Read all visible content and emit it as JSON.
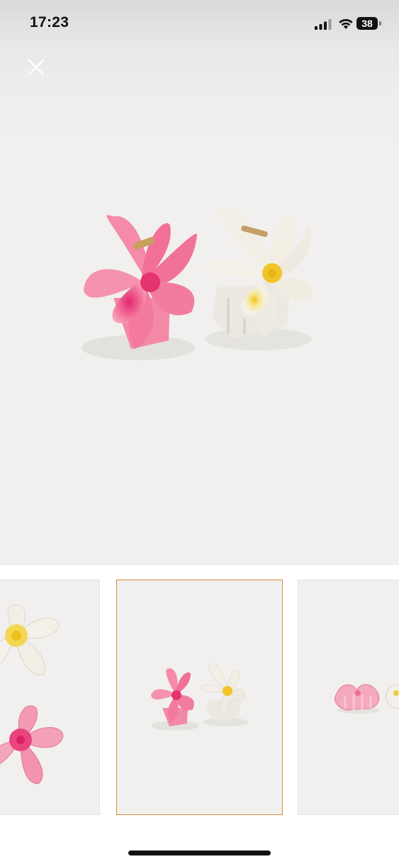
{
  "status_bar": {
    "time": "17:23",
    "battery_level": "38",
    "signal_icon": "cellular-signal-icon",
    "wifi_icon": "wifi-icon"
  },
  "toolbar": {
    "close_icon": "close-icon"
  },
  "gallery": {
    "selected_thumbnail_index": 1,
    "thumbnail_count": 3,
    "accent_color": "#e08a3c",
    "product_colors": {
      "pink": "#f07a9c",
      "white": "#f4f1ea",
      "center_yellow": "#f2cf2e"
    }
  }
}
